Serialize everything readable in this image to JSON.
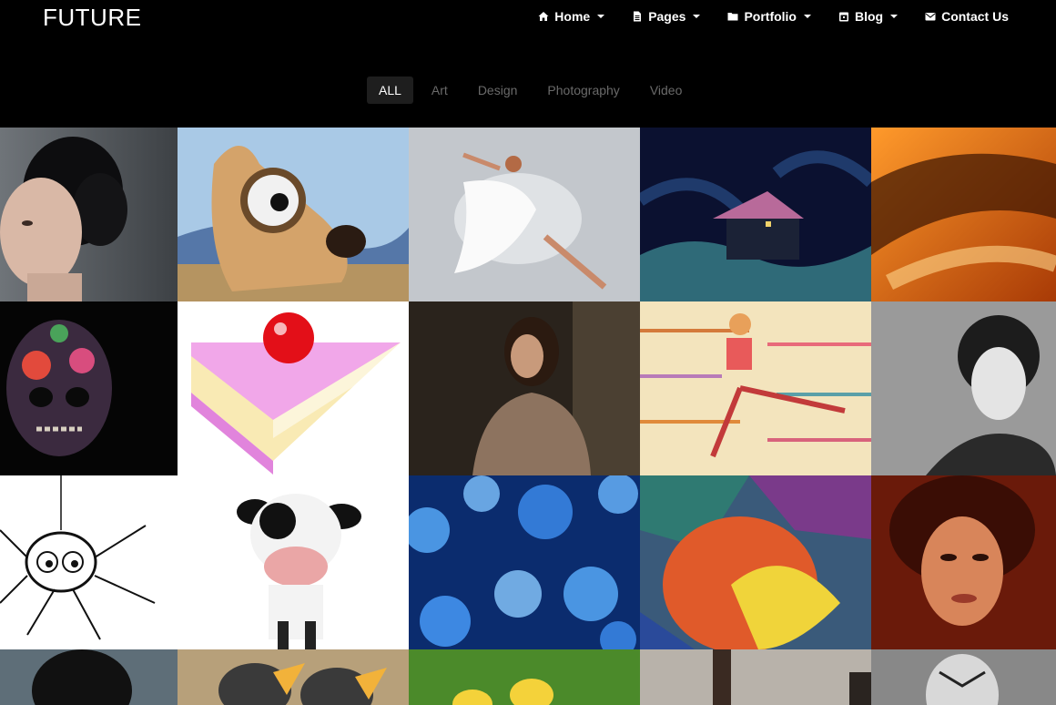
{
  "brand": {
    "logo": "FUTURE"
  },
  "nav": {
    "items": [
      {
        "label": "Home",
        "icon": "home-icon",
        "dropdown": true
      },
      {
        "label": "Pages",
        "icon": "page-icon",
        "dropdown": true
      },
      {
        "label": "Portfolio",
        "icon": "folder-icon",
        "dropdown": true
      },
      {
        "label": "Blog",
        "icon": "calendar-icon",
        "dropdown": true
      },
      {
        "label": "Contact Us",
        "icon": "envelope-icon",
        "dropdown": false
      }
    ]
  },
  "filters": {
    "items": [
      "ALL",
      "Art",
      "Design",
      "Photography",
      "Video"
    ],
    "active": "ALL"
  },
  "portfolio": {
    "tiles": [
      {
        "subject": "woman-portrait-dark-hair"
      },
      {
        "subject": "cartoon-dog-with-goggle"
      },
      {
        "subject": "dancer-water-splash"
      },
      {
        "subject": "house-at-night-on-waves"
      },
      {
        "subject": "orange-abstract"
      },
      {
        "subject": "flower-painted-skull-face"
      },
      {
        "subject": "cake-slice-with-cherry"
      },
      {
        "subject": "woman-brown-dress"
      },
      {
        "subject": "running-girl-illustration"
      },
      {
        "subject": "woman-bw-portrait"
      },
      {
        "subject": "scribble-spider"
      },
      {
        "subject": "cartoon-cow"
      },
      {
        "subject": "blue-bokeh"
      },
      {
        "subject": "stained-glass-drawing"
      },
      {
        "subject": "woman-red-light-portrait"
      },
      {
        "subject": "woman-portrait-partial"
      },
      {
        "subject": "baby-birds"
      },
      {
        "subject": "ducklings-on-grass"
      },
      {
        "subject": "statue-silhouette-sky"
      },
      {
        "subject": "man-bw-portrait"
      }
    ]
  }
}
